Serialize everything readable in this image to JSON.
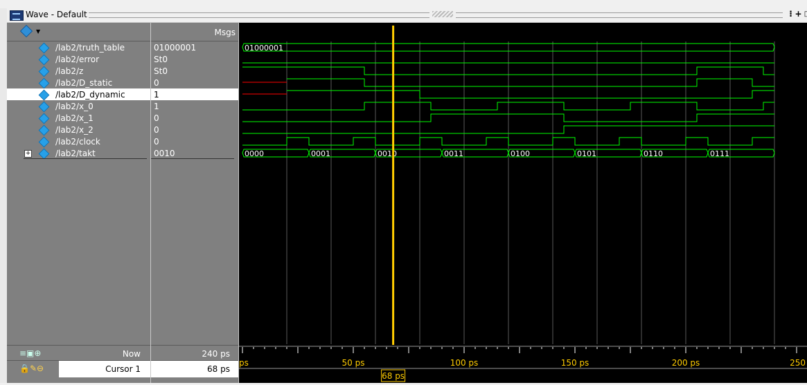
{
  "window": {
    "title": "Wave - Default"
  },
  "columns": {
    "msgs_header": "Msgs"
  },
  "signals": [
    {
      "name": "/lab2/truth_table",
      "value": "01000001"
    },
    {
      "name": "/lab2/error",
      "value": "St0"
    },
    {
      "name": "/lab2/z",
      "value": "St0"
    },
    {
      "name": "/lab2/D_static",
      "value": "0"
    },
    {
      "name": "/lab2/D_dynamic",
      "value": "1"
    },
    {
      "name": "/lab2/x_0",
      "value": "1"
    },
    {
      "name": "/lab2/x_1",
      "value": "0"
    },
    {
      "name": "/lab2/x_2",
      "value": "0"
    },
    {
      "name": "/lab2/clock",
      "value": "0"
    },
    {
      "name": "/lab2/takt",
      "value": "0010"
    }
  ],
  "footer": {
    "now_label": "Now",
    "now_value": "240 ps",
    "cursor_label": "Cursor 1",
    "cursor_value": "68 ps",
    "cursor_marker": "68 ps"
  },
  "timeline": {
    "unit": "ps",
    "visible_start": 0,
    "visible_end": 250,
    "cursor_time": 68,
    "tick_labels": [
      "ps",
      "50 ps",
      "100 ps",
      "150 ps",
      "200 ps",
      "250"
    ]
  },
  "bus_values": {
    "truth_table": [
      "01000001"
    ],
    "takt": [
      "0000",
      "0001",
      "0010",
      "0011",
      "0100",
      "0101",
      "0110",
      "0111"
    ]
  },
  "colors": {
    "wave_background": "#000000",
    "signal": "#00ff00",
    "cursor": "#ffcc00",
    "uninitialized": "#ff0000",
    "panel": "#808080"
  }
}
